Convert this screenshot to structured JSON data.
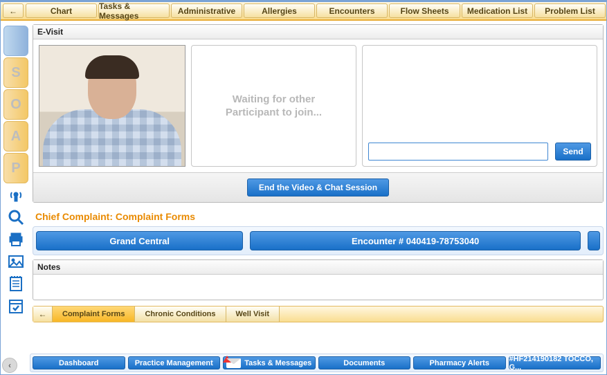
{
  "topnav": {
    "back_glyph": "←",
    "tabs": [
      "Chart",
      "Tasks & Messages",
      "Administrative",
      "Allergies",
      "Encounters",
      "Flow Sheets",
      "Medication List",
      "Problem List"
    ]
  },
  "soap": [
    "",
    "S",
    "O",
    "A",
    "P"
  ],
  "evisit": {
    "title": "E-Visit",
    "waiting_text": "Waiting for other\nParticipant to join...",
    "send_label": "Send",
    "end_label": "End the Video & Chat Session"
  },
  "cc": {
    "heading": "Chief Complaint: Complaint Forms",
    "grand_central": "Grand Central",
    "encounter": "Encounter # 040419-78753040"
  },
  "notes": {
    "title": "Notes"
  },
  "subtabs": {
    "back_glyph": "←",
    "items": [
      "Complaint Forms",
      "Chronic Conditions",
      "Well Visit"
    ],
    "active_index": 0
  },
  "bottom": {
    "dashboard": "Dashboard",
    "practice": "Practice Management",
    "tasks": "Tasks & Messages",
    "documents": "Documents",
    "pharmacy": "Pharmacy Alerts",
    "patient": "#HF214190182  TOCCO, G..."
  }
}
